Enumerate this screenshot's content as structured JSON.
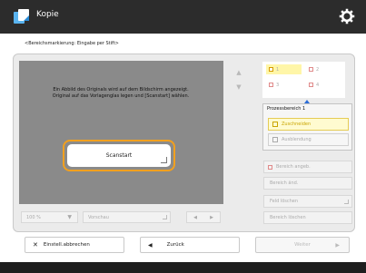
{
  "header": {
    "title": "Kopie"
  },
  "breadcrumb": "<Bereichsmarkierung: Eingabe per Stift>",
  "preview": {
    "message_lines": [
      "Ein Abbild des Originals wird auf dem Bildschirm angezeigt.",
      "Original auf das Vorlagenglas legen und [Scanstart] wählen."
    ],
    "scan_button": "Scanstart"
  },
  "zones": [
    {
      "label": "1",
      "selected": true
    },
    {
      "label": "2",
      "selected": false
    },
    {
      "label": "3",
      "selected": false
    },
    {
      "label": "4",
      "selected": false
    }
  ],
  "range": {
    "title": "Prozessbereich 1",
    "option_trim": "Zuschneiden",
    "option_mask": "Ausblendung"
  },
  "side_buttons": {
    "add": "Bereich angeb.",
    "change": "Bereich änd.",
    "rotate": "Feld löschen",
    "delete": "Bereich löschen"
  },
  "preview_controls": {
    "zoom": "100 %",
    "view": "Vorschau",
    "nav_prev": "◀",
    "nav_next": "▶"
  },
  "footer": {
    "cancel": "Einstell.abbrechen",
    "back": "Zurück",
    "next": "Weiter"
  },
  "colors": {
    "accent_orange": "#f2a01e",
    "selected_yellow": "#fff6a8",
    "topbar": "#2c2c2c"
  },
  "icons": {
    "app": "copy-icon",
    "settings": "gear-icon"
  }
}
